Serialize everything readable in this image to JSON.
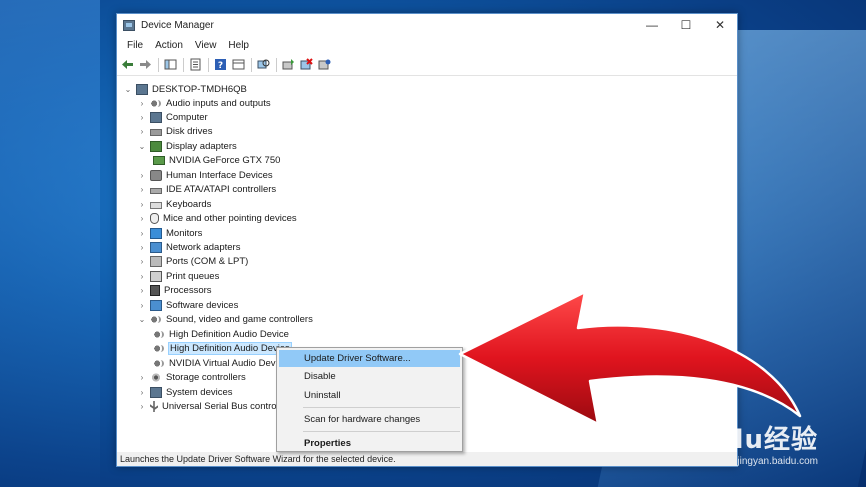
{
  "window": {
    "title": "Device Manager",
    "controls": {
      "minimize": "—",
      "maximize": "☐",
      "close": "✕"
    }
  },
  "menu": [
    "File",
    "Action",
    "View",
    "Help"
  ],
  "tree": {
    "root": "DESKTOP-TMDH6QB",
    "items": [
      {
        "label": "Audio inputs and outputs",
        "icon": "speaker-icon",
        "expanded": false
      },
      {
        "label": "Computer",
        "icon": "computer-icon",
        "expanded": false
      },
      {
        "label": "Disk drives",
        "icon": "disk-drive-icon",
        "expanded": false
      },
      {
        "label": "Display adapters",
        "icon": "display-adapter-icon",
        "expanded": true
      },
      {
        "label": "NVIDIA GeForce GTX 750",
        "icon": "gpu-icon",
        "child": true
      },
      {
        "label": "Human Interface Devices",
        "icon": "hid-icon",
        "expanded": false
      },
      {
        "label": "IDE ATA/ATAPI controllers",
        "icon": "ide-controller-icon",
        "expanded": false
      },
      {
        "label": "Keyboards",
        "icon": "keyboard-icon",
        "expanded": false
      },
      {
        "label": "Mice and other pointing devices",
        "icon": "mouse-icon",
        "expanded": false
      },
      {
        "label": "Monitors",
        "icon": "monitor-icon",
        "expanded": false
      },
      {
        "label": "Network adapters",
        "icon": "network-adapter-icon",
        "expanded": false
      },
      {
        "label": "Ports (COM & LPT)",
        "icon": "port-icon",
        "expanded": false
      },
      {
        "label": "Print queues",
        "icon": "printer-icon",
        "expanded": false
      },
      {
        "label": "Processors",
        "icon": "processor-icon",
        "expanded": false
      },
      {
        "label": "Software devices",
        "icon": "software-device-icon",
        "expanded": false
      },
      {
        "label": "Sound, video and game controllers",
        "icon": "speaker-icon",
        "expanded": true
      },
      {
        "label": "High Definition Audio Device",
        "icon": "speaker-icon",
        "child": true
      },
      {
        "label": "High Definition Audio Device",
        "icon": "speaker-icon",
        "child": true,
        "selected": true
      },
      {
        "label": "NVIDIA Virtual Audio Device",
        "icon": "speaker-icon",
        "child": true
      },
      {
        "label": "Storage controllers",
        "icon": "storage-controller-icon",
        "expanded": false
      },
      {
        "label": "System devices",
        "icon": "system-device-icon",
        "expanded": false
      },
      {
        "label": "Universal Serial Bus controllers",
        "icon": "usb-icon",
        "expanded": false
      }
    ]
  },
  "context_menu": {
    "items": [
      "Update Driver Software...",
      "Disable",
      "Uninstall"
    ],
    "scan": "Scan for hardware changes",
    "properties": "Properties"
  },
  "status": "Launches the Update Driver Software Wizard for the selected device.",
  "watermark": {
    "logo": "Baidu经验",
    "url": "jingyan.baidu.com"
  },
  "colors": {
    "arrow_red": "#e0141e",
    "desktop_blue": "#0f5aa8",
    "menu_hover": "#91c9f7"
  }
}
